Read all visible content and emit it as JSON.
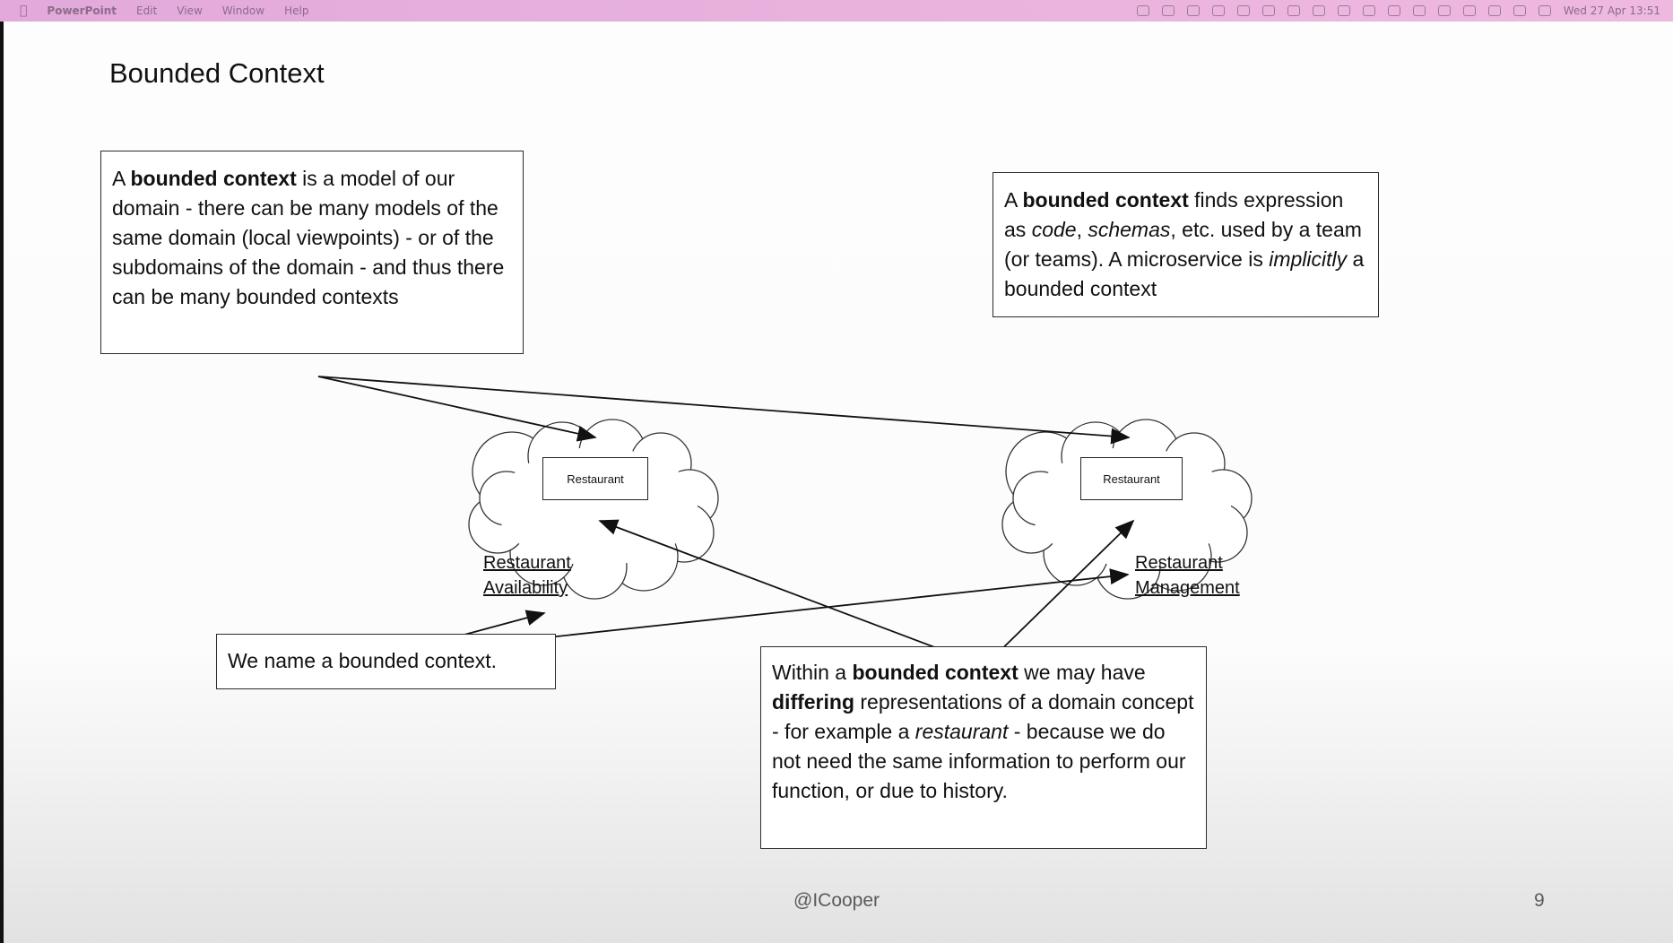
{
  "menubar": {
    "app": "PowerPoint",
    "items": [
      "Edit",
      "View",
      "Window",
      "Help"
    ],
    "clock": "Wed 27 Apr  13:51"
  },
  "slide": {
    "title": "Bounded Context",
    "box1": {
      "t1": "A ",
      "b1": "bounded context",
      "t2": " is a model of our domain - there can be many models of the same domain (local viewpoints) - or of the subdomains of the domain -  and thus there can be many bounded contexts"
    },
    "box2": {
      "t1": "A ",
      "b1": "bounded context",
      "t2": " finds expression as ",
      "i1": "code",
      "t3": ", ",
      "i2": "schemas",
      "t4": ", etc. used by a team (or teams). A microservice is ",
      "i3": "implicitly",
      "t5": " a bounded context"
    },
    "box3": {
      "text": "We name a bounded context."
    },
    "box4": {
      "t1": "Within a ",
      "b1": "bounded context",
      "t2": " we may have ",
      "b2": "differing",
      "t3": " representations of a domain concept - for example a ",
      "i1": "restaurant",
      "t4": " - because we do not need the same information to perform our function, or due to history."
    },
    "clouds": [
      {
        "entity": "Restaurant",
        "label_line1": "Restaurant",
        "label_line2": "Availability"
      },
      {
        "entity": "Restaurant",
        "label_line1": "Restaurant",
        "label_line2": "Management"
      }
    ],
    "footer_handle": "@ICooper",
    "page_number": "9"
  }
}
